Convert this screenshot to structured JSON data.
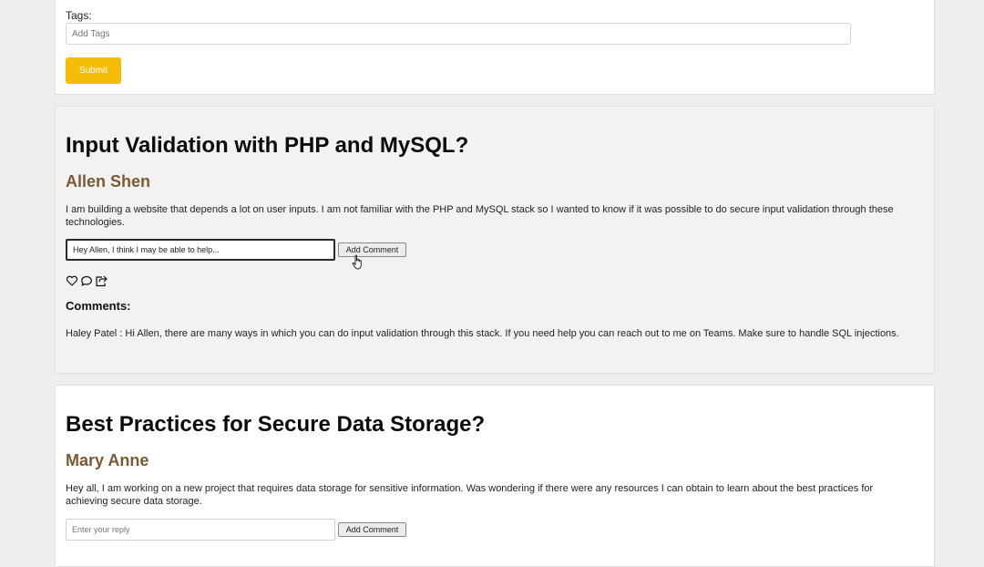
{
  "question_form": {
    "tags_label": "Tags:",
    "tags_placeholder": "Add Tags",
    "submit_label": "Submit"
  },
  "posts": [
    {
      "title": "Input Validation with PHP and MySQL?",
      "author": "Allen Shen",
      "body": "I am building a website that depends a lot on user inputs. I am not familiar with the PHP and MySQL stack so I wanted to know if it was possible to do secure input validation through these technologies.",
      "reply_value": "Hey Allen, I think I may be able to help...",
      "add_comment_label": "Add Comment",
      "actions": [
        "heart-icon",
        "comment-icon",
        "share-icon"
      ],
      "comments_heading": "Comments:",
      "comments": [
        {
          "text": "Haley Patel : Hi Allen, there are many ways in which you can do input validation through this stack. If you need help you can reach out to me on Teams. Make sure to handle SQL injections."
        }
      ]
    },
    {
      "title": "Best Practices for Secure Data Storage?",
      "author": "Mary Anne",
      "body": "Hey all, I am working on a new project that requires data storage for sensitive information. Was wondering if there were any resources I can obtain to learn about the best practices for achieving secure data storage.",
      "reply_placeholder": "Enter your reply",
      "add_comment_label": "Add Comment"
    }
  ],
  "colors": {
    "background": "#f0eeed",
    "submit_button": "#f5bd08",
    "author_name": "#7a5a32"
  }
}
